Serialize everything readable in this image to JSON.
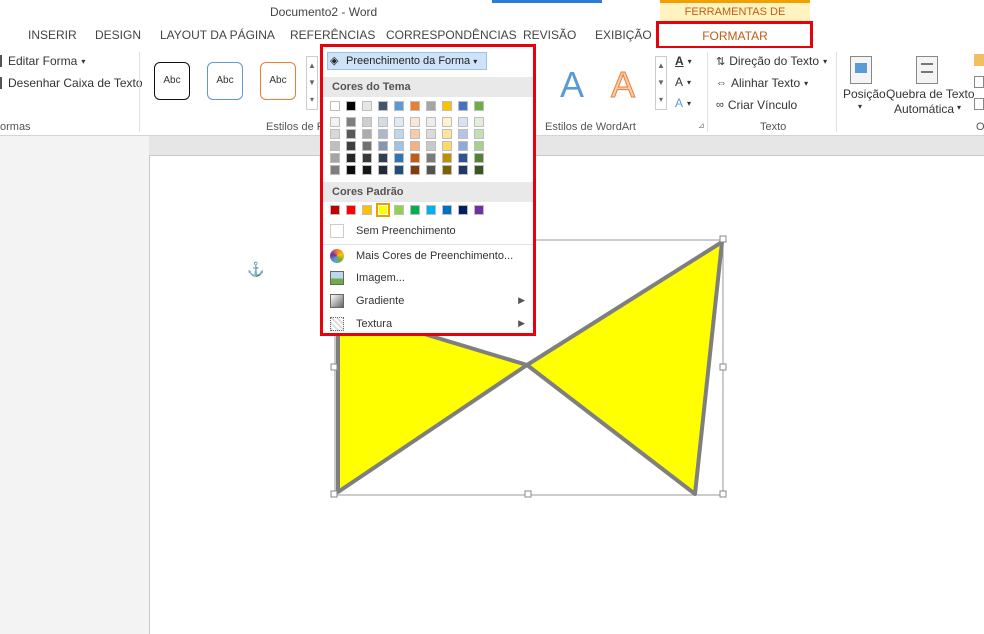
{
  "title": "Documento2 - Word",
  "context_tab_group": "FERRAMENTAS DE DESENHO",
  "tabs": [
    {
      "label": "INSERIR"
    },
    {
      "label": "DESIGN"
    },
    {
      "label": "LAYOUT DA PÁGINA"
    },
    {
      "label": "REFERÊNCIAS"
    },
    {
      "label": "CORRESPONDÊNCIAS"
    },
    {
      "label": "REVISÃO"
    },
    {
      "label": "EXIBIÇÃO"
    },
    {
      "label": "FORMATAR",
      "active": true
    }
  ],
  "ribbon": {
    "edit_shape": "Editar Forma",
    "draw_textbox": "Desenhar Caixa de Texto",
    "group_shapes": "ormas",
    "style_sample": "Abc",
    "group_styles": "Estilos de F",
    "group_wordart": "Estilos de WordArt",
    "text_direction": "Direção do Texto",
    "align_text": "Alinhar Texto",
    "create_link": "Criar Vínculo",
    "group_text": "Texto",
    "position": "Posição",
    "wrap_text_1": "Quebra de Texto",
    "wrap_text_2": "Automática",
    "group_partial": "O"
  },
  "fill_menu": {
    "header": "Preenchimento da Forma",
    "theme_colors_title": "Cores do Tema",
    "standard_colors_title": "Cores Padrão",
    "no_fill": "Sem Preenchimento",
    "more_colors": "Mais Cores de Preenchimento...",
    "image": "Imagem...",
    "gradient": "Gradiente",
    "texture": "Textura",
    "theme_top_row": [
      "#ffffff",
      "#000000",
      "#e7e6e6",
      "#44546a",
      "#5b9bd5",
      "#ed7d31",
      "#a5a5a5",
      "#ffc000",
      "#4472c4",
      "#70ad47"
    ],
    "theme_shades": [
      [
        "#f2f2f2",
        "#7f7f7f",
        "#d0cece",
        "#d6dce4",
        "#deebf6",
        "#fbe5d5",
        "#ededed",
        "#fff2cc",
        "#dae3f3",
        "#e2efd9"
      ],
      [
        "#d8d8d8",
        "#595959",
        "#aeabab",
        "#adb9ca",
        "#bdd7ee",
        "#f7cbac",
        "#dbdbdb",
        "#fee599",
        "#b4c6e7",
        "#c5e0b3"
      ],
      [
        "#bfbfbf",
        "#3f3f3f",
        "#757070",
        "#8496b0",
        "#9dc3e6",
        "#f4b183",
        "#c9c9c9",
        "#ffd965",
        "#8eaadb",
        "#a8d08d"
      ],
      [
        "#a5a5a5",
        "#262626",
        "#3a3838",
        "#323f4f",
        "#2e75b5",
        "#c55a11",
        "#7b7b7b",
        "#bf9000",
        "#2f5496",
        "#538135"
      ],
      [
        "#7f7f7f",
        "#0c0c0c",
        "#171616",
        "#222a35",
        "#1e4e79",
        "#833c0b",
        "#525252",
        "#7f6000",
        "#1f3864",
        "#375623"
      ]
    ],
    "standard_colors": [
      "#c00000",
      "#ff0000",
      "#ffc000",
      "#ffff00",
      "#92d050",
      "#00b050",
      "#00b0f0",
      "#0070c0",
      "#002060",
      "#7030a0"
    ],
    "selected_standard": 3
  },
  "shape": {
    "fill": "#ffff00",
    "outline": "#7f7f7f"
  },
  "colors": {
    "highlight_red": "#e8000b",
    "accent_orange": "#c55a11"
  }
}
